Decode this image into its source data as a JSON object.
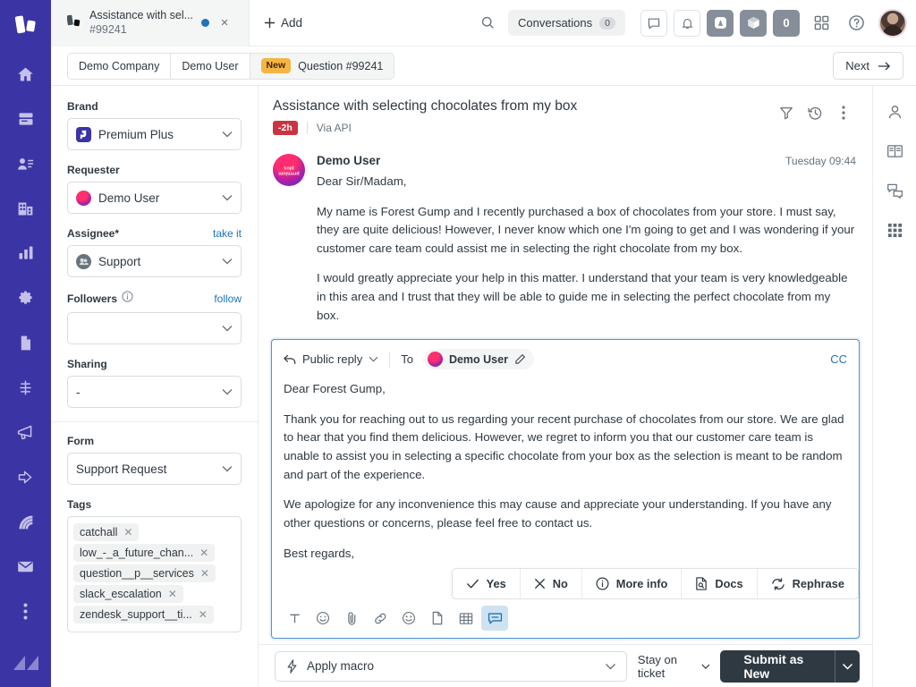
{
  "left_rail": {
    "logo": "premium-plus-logo",
    "items": [
      {
        "icon": "home-icon",
        "name": "home"
      },
      {
        "icon": "views-icon",
        "name": "views"
      },
      {
        "icon": "customers-icon",
        "name": "customers"
      },
      {
        "icon": "organizations-icon",
        "name": "organizations"
      },
      {
        "icon": "reporting-icon",
        "name": "reporting"
      },
      {
        "icon": "settings-icon",
        "name": "settings"
      },
      {
        "icon": "document-icon",
        "name": "documents"
      },
      {
        "icon": "workflow-icon",
        "name": "workflow"
      },
      {
        "icon": "megaphone-icon",
        "name": "announcements"
      },
      {
        "icon": "share-arrow-icon",
        "name": "share"
      },
      {
        "icon": "signal-icon",
        "name": "live-data"
      },
      {
        "icon": "envelope-icon",
        "name": "mail"
      },
      {
        "icon": "more-vertical-icon",
        "name": "more"
      }
    ],
    "footer_logo": "zendesk-logo"
  },
  "topbar": {
    "tab": {
      "title": "Assistance with sel...",
      "subtitle": "#99241",
      "icon": "ticket-brand-icon",
      "status_dot_color": "#1f73b7",
      "close_label": "×"
    },
    "add_label": "Add",
    "search_icon": "search-icon",
    "conversations_label": "Conversations",
    "conversations_count": "0",
    "icons": [
      {
        "name": "chat-icon",
        "style": "outline"
      },
      {
        "name": "bell-icon",
        "style": "outline"
      },
      {
        "name": "guide-icon",
        "style": "filled"
      },
      {
        "name": "apps-box-icon",
        "style": "filled"
      },
      {
        "name": "zero-badge-icon",
        "style": "filled",
        "label": "0"
      },
      {
        "name": "products-grid-icon",
        "style": "plain"
      },
      {
        "name": "help-icon",
        "style": "plain"
      }
    ],
    "avatar": "user-avatar"
  },
  "breadcrumb": {
    "items": [
      {
        "label": "Demo Company"
      },
      {
        "label": "Demo User"
      }
    ],
    "current": {
      "badge": "New",
      "label": "Question #99241"
    },
    "next_label": "Next"
  },
  "sidebar": {
    "brand": {
      "label": "Brand",
      "value": "Premium Plus"
    },
    "requester": {
      "label": "Requester",
      "value": "Demo User"
    },
    "assignee": {
      "label": "Assignee*",
      "action": "take it",
      "value": "Support"
    },
    "followers": {
      "label": "Followers",
      "action": "follow",
      "value": ""
    },
    "sharing": {
      "label": "Sharing",
      "value": "-"
    },
    "form": {
      "label": "Form",
      "value": "Support Request"
    },
    "tags": {
      "label": "Tags",
      "items": [
        "catchall",
        "low_-_a_future_chan...",
        "question__p__services",
        "slack_escalation",
        "zendesk_support__ti..."
      ]
    }
  },
  "ticket": {
    "title": "Assistance with selecting chocolates from my box",
    "sla_badge": "-2h",
    "via": "Via API",
    "header_icons": [
      {
        "name": "filter-icon"
      },
      {
        "name": "history-icon"
      },
      {
        "name": "more-vertical-icon"
      }
    ],
    "message": {
      "author": "Demo User",
      "time": "Tuesday 09:44",
      "avatar_text": "premium plus",
      "paragraphs": [
        "Dear Sir/Madam,",
        "My name is Forest Gump and I recently purchased a box of chocolates from your store. I must say, they are quite delicious! However, I never know which one I'm going to get and I was wondering if your customer care team could assist me in selecting the right chocolate from my box.",
        "I would greatly appreciate your help in this matter. I understand that your team is very knowledgeable in this area and I trust that they will be able to guide me in selecting the perfect chocolate from my box."
      ]
    }
  },
  "composer": {
    "reply_type": "Public reply",
    "to_label": "To",
    "recipient": "Demo User",
    "edit_icon": "pencil-icon",
    "cc_label": "CC",
    "paragraphs": [
      "Dear Forest Gump,",
      "Thank you for reaching out to us regarding your recent purchase of chocolates from our store. We are glad to hear that you find them delicious. However, we regret to inform you that our customer care team is unable to assist you in selecting a specific chocolate from your box as the selection is meant to be random and part of the experience.",
      "We apologize for any inconvenience this may cause and appreciate your understanding. If you have any other questions or concerns, please feel free to contact us.",
      "Best regards,"
    ],
    "ai_actions": [
      {
        "label": "Yes",
        "icon": "check-icon"
      },
      {
        "label": "No",
        "icon": "x-icon"
      },
      {
        "label": "More info",
        "icon": "info-icon"
      },
      {
        "label": "Docs",
        "icon": "doc-search-icon"
      },
      {
        "label": "Rephrase",
        "icon": "refresh-icon"
      }
    ],
    "tools": [
      {
        "name": "text-format-icon",
        "active": false
      },
      {
        "name": "emoji-outline-icon",
        "active": false
      },
      {
        "name": "attachment-icon",
        "active": false
      },
      {
        "name": "link-icon",
        "active": false
      },
      {
        "name": "emoji-icon",
        "active": false
      },
      {
        "name": "file-icon",
        "active": false
      },
      {
        "name": "table-icon",
        "active": false
      },
      {
        "name": "comment-bubble-icon",
        "active": true
      }
    ]
  },
  "footer": {
    "macro_label": "Apply macro",
    "macro_icon": "lightning-icon",
    "stay_label": "Stay on ticket",
    "submit_label": "Submit as New"
  },
  "right_rail": [
    {
      "name": "user-icon"
    },
    {
      "name": "knowledge-book-icon"
    },
    {
      "name": "conversations-icon"
    },
    {
      "name": "apps-grid-icon"
    }
  ],
  "colors": {
    "rail_bg": "#3b34a5",
    "accent_blue": "#1f73b7",
    "sla_red": "#cc3340",
    "badge_amber": "#f5b544",
    "submit_dark": "#2f3941"
  }
}
